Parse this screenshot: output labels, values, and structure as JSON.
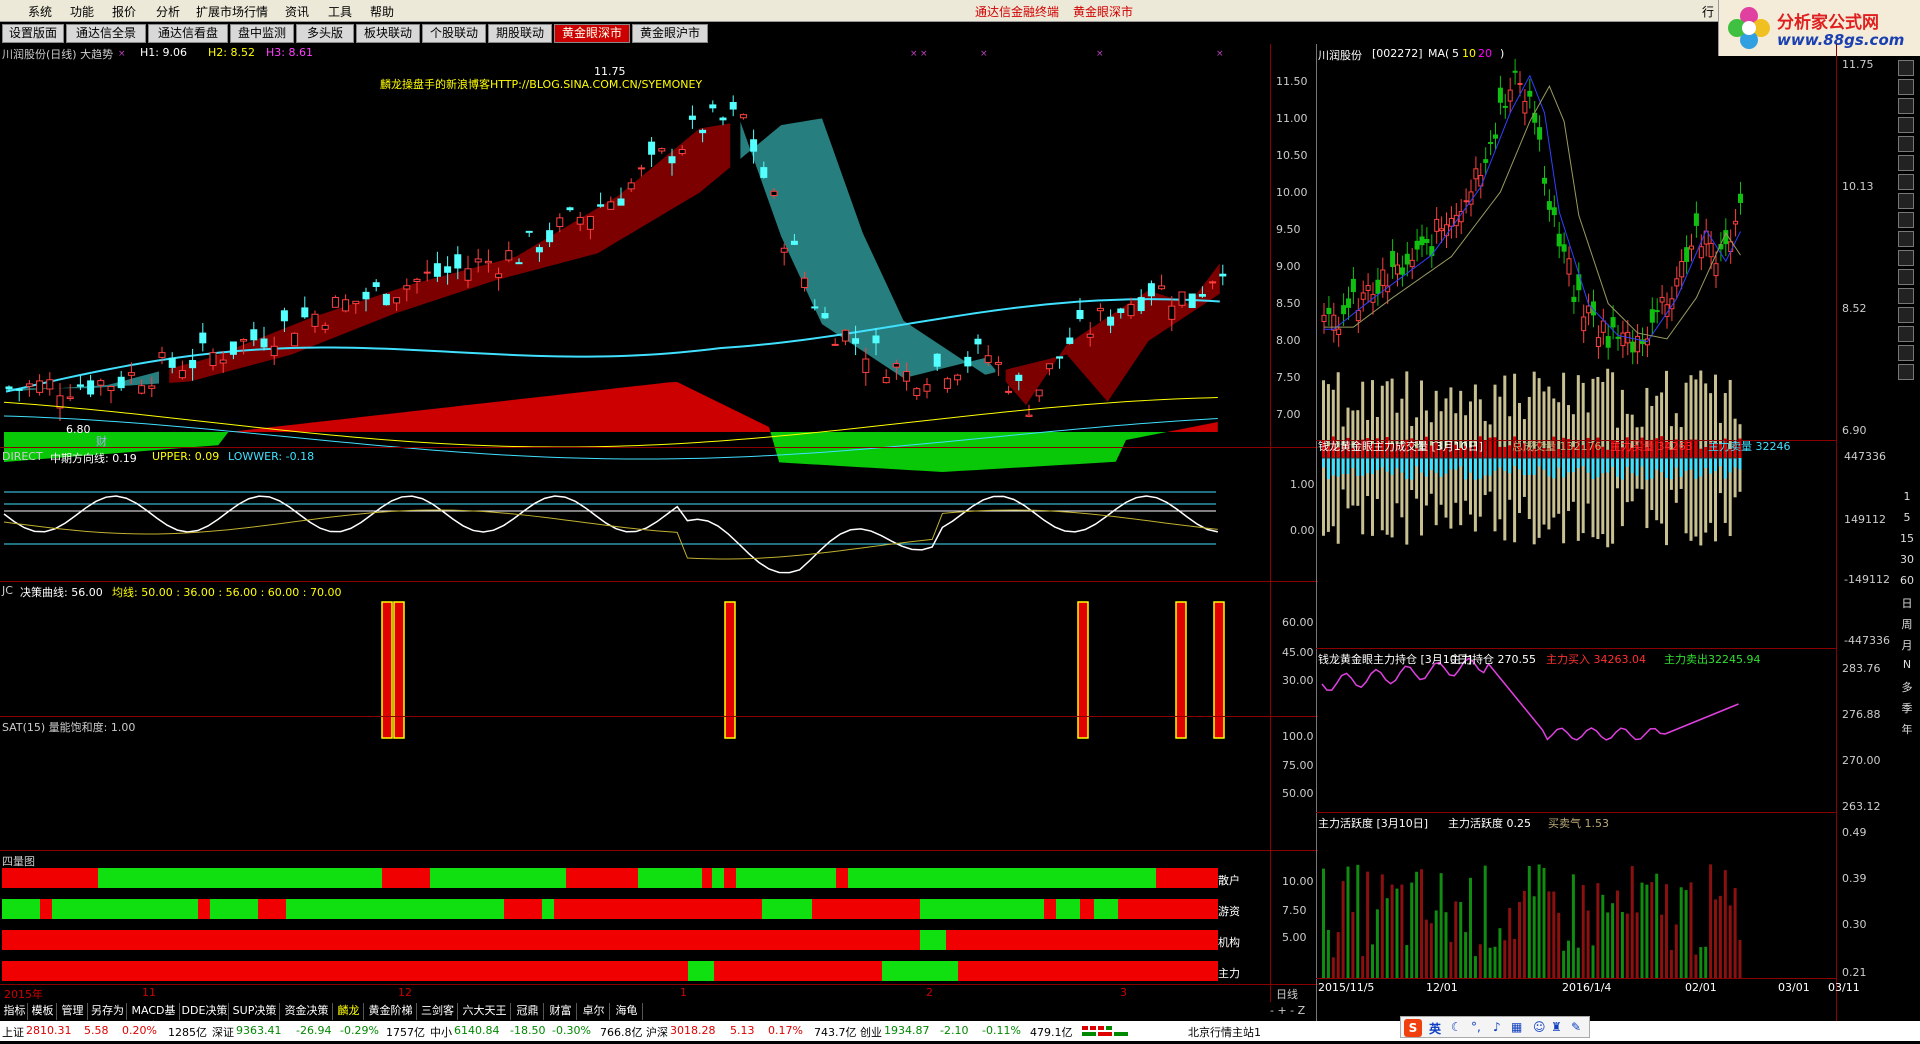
{
  "menu": {
    "items": [
      "系统",
      "功能",
      "报价",
      "分析",
      "扩展市场行情",
      "资讯",
      "工具",
      "帮助"
    ],
    "title1": "通达信金融终端",
    "title2": "黄金眼深市"
  },
  "logo": {
    "line1": "分析家公式网",
    "line2": "www.88gs.com",
    "corner": "行"
  },
  "tabs": [
    "设置版面",
    "通达信全景",
    "通达信看盘",
    "盘中监测",
    "多头版",
    "板块联动",
    "个股联动",
    "期股联动",
    "黄金眼深市",
    "黄金眼沪市"
  ],
  "active_tab": "黄金眼深市",
  "main": {
    "header": {
      "title": "川润股份(日线) 大趋势",
      "h1": "H1: 9.06",
      "h2": "H2: 8.52",
      "h3": "H3: 8.61"
    },
    "watermark": "麟龙操盘手的新浪博客HTTP://BLOG.SINA.COM.CN/SYEMONEY",
    "max_label": "11.75",
    "min_label": "6.80",
    "cai": "财",
    "yticks": [
      "11.50",
      "11.00",
      "10.50",
      "10.00",
      "9.50",
      "9.00",
      "8.50",
      "8.00",
      "7.50",
      "7.00"
    ]
  },
  "direct": {
    "name": "DIRECT",
    "label": "中期方向线: 0.19",
    "upper": "UPPER: 0.09",
    "lower": "LOWWER: -0.18",
    "yticks": [
      "1.00",
      "0.00"
    ]
  },
  "jc": {
    "name": "JC",
    "label": "决策曲线: 56.00",
    "avg": "均线: 50.00 : 36.00 : 56.00 : 60.00 : 70.00",
    "yticks": [
      "60.00",
      "45.00",
      "30.00"
    ]
  },
  "sat": {
    "label": "SAT(15) 量能饱和度: 1.00",
    "yticks": [
      "100.0",
      "75.00",
      "50.00"
    ]
  },
  "four": {
    "title": "四量图",
    "rows": [
      "散户",
      "游资",
      "机构",
      "主力"
    ],
    "yticks": [
      "10.00",
      "7.50",
      "5.00"
    ]
  },
  "xaxis": {
    "labels": [
      "2015年",
      "11",
      "12",
      "1",
      "2",
      "3"
    ],
    "mode": "日线"
  },
  "bottom_tabs": [
    "指标",
    "模板",
    "管理",
    "另存为",
    "MACD基本",
    "DDE决策",
    "SUP决策",
    "资金决策",
    "麟龙",
    "黄金阶梯",
    "三剑客",
    "六大天王",
    "冠鼎",
    "财富",
    "卓尔",
    "海龟"
  ],
  "right": {
    "header": {
      "name": "川润股份",
      "code": "[002272]",
      "ma": "MA(",
      "p1": "5",
      "p2": "10",
      "p3": "20",
      "close": ")"
    },
    "ymax": "11.75",
    "ymid": "10.13",
    "yref": "8.52",
    "ymin": "6.90",
    "vol": {
      "title": "钱龙黄金眼主力成交量 [3月10日]",
      "total": "总成交量 132176",
      "buy": "主力买量 34263",
      "sell": "主力卖量 32246",
      "yticks": [
        "447336",
        "149112",
        "-149112",
        "-447336"
      ]
    },
    "hold": {
      "title": "钱龙黄金眼主力持仓 [3月10日]",
      "val": "主力持仓 270.55",
      "buy": "主力买入 34263.04",
      "sell": "主力卖出32245.94",
      "yticks": [
        "283.76",
        "276.88",
        "270.00",
        "263.12"
      ]
    },
    "act": {
      "title": "主力活跃度 [3月10日]",
      "val": "主力活跃度 0.25",
      "qi": "买卖气 1.53",
      "yticks": [
        "0.49",
        "0.39",
        "0.30",
        "0.21"
      ]
    },
    "xlabels": [
      "2015/11/5",
      "12/01",
      "2016/1/4",
      "02/01",
      "03/01",
      "03/11"
    ]
  },
  "sidebar": [
    "1",
    "5",
    "15",
    "30",
    "60",
    "日",
    "周",
    "月",
    "N",
    "多",
    "季",
    "年"
  ],
  "status": {
    "sh": "上证",
    "sh_v": "2810.31",
    "sh_c": "5.58",
    "sh_p": "0.20%",
    "sh_a": "1285亿",
    "sz": "深证",
    "sz_v": "9363.41",
    "sz_c": "-26.94",
    "sz_p": "-0.29%",
    "sz_a": "1757亿",
    "zx": "中小",
    "zx_v": "6140.84",
    "zx_c": "-18.50",
    "zx_p": "-0.30%",
    "zx_a": "766.8亿",
    "hs": "沪深",
    "hs_v": "3018.28",
    "hs_c": "5.13",
    "hs_p": "0.17%",
    "hs_a": "743.7亿",
    "cy": "创业",
    "cy_v": "1934.87",
    "cy_c": "-2.10",
    "cy_p": "-0.11%",
    "cy_a": "479.1亿",
    "server": "北京行情主站1",
    "ime": "英"
  }
}
